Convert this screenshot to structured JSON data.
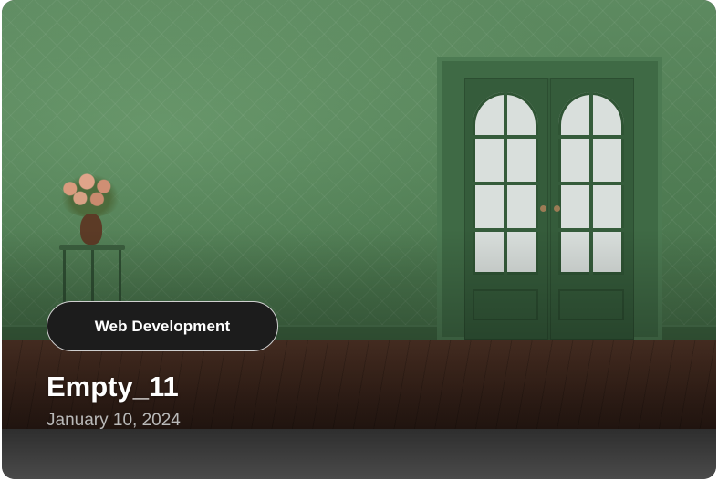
{
  "card": {
    "category_tag": "Web Development",
    "title": "Empty_11",
    "date": "January 10, 2024"
  },
  "colors": {
    "tag_background": "#1c1c1c",
    "wall": "#4f7c53",
    "floor": "#4a2e22"
  }
}
